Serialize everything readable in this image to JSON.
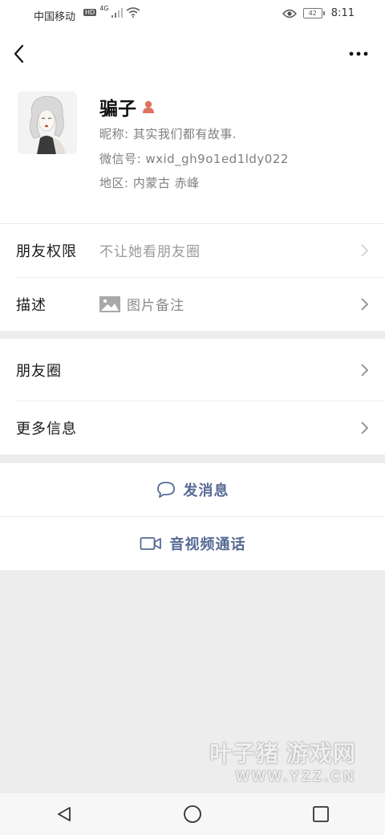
{
  "status_bar": {
    "carrier": "中国移动",
    "network": "4G",
    "battery": "42",
    "time": "8:11"
  },
  "profile": {
    "name": "骗子",
    "nickname": "昵称: 其实我们都有故事.",
    "wechat_id": "微信号: wxid_gh9o1ed1ldy022",
    "region": "地区: 内蒙古  赤峰"
  },
  "rows": {
    "friend_permissions": {
      "label": "朋友权限",
      "value": "不让她看朋友圈"
    },
    "description": {
      "label": "描述",
      "value": "图片备注"
    },
    "moments": {
      "label": "朋友圈"
    },
    "more_info": {
      "label": "更多信息"
    }
  },
  "actions": {
    "send_message": "发消息",
    "video_call": "音视频通话"
  },
  "watermark": {
    "main": "叶子猪 游戏网",
    "url": "WWW.YZZ.CN"
  },
  "colors": {
    "link_blue": "#576b95",
    "background": "#ededed",
    "gender_icon": "#e0735f"
  }
}
